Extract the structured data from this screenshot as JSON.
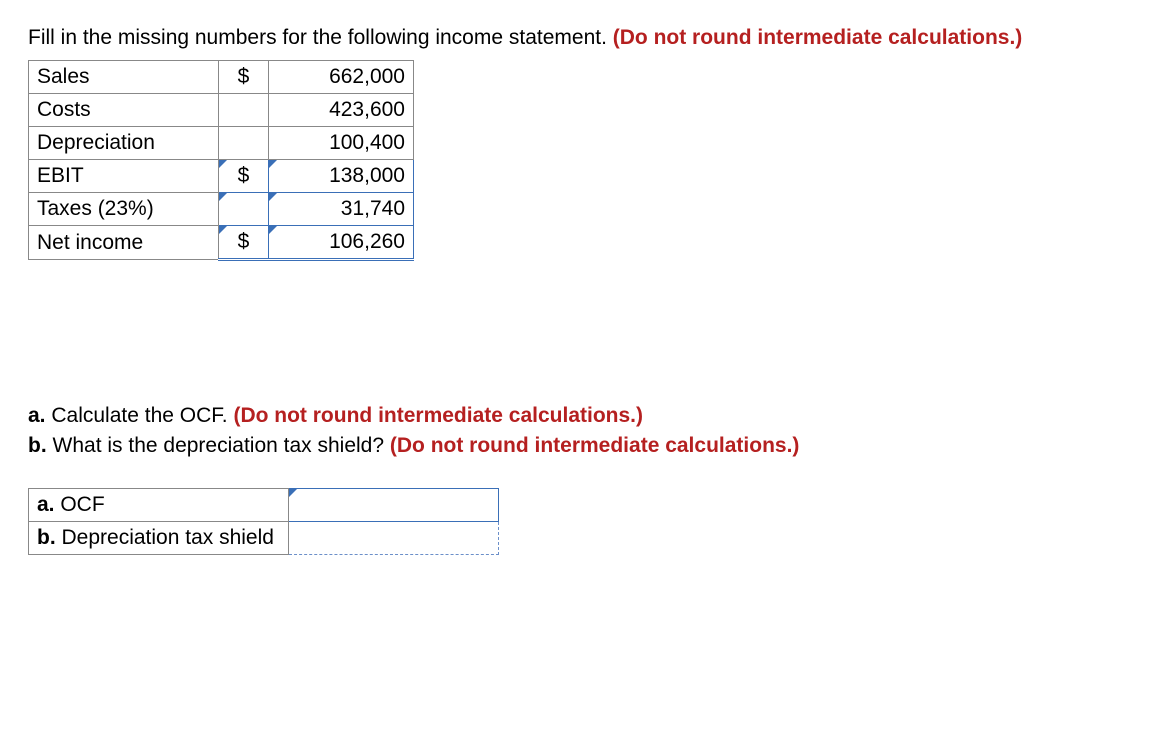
{
  "prompt": {
    "text_before": "Fill in the missing numbers for the following income statement. ",
    "red_text": "(Do not round intermediate calculations.)"
  },
  "income_table": {
    "rows": [
      {
        "label": "Sales",
        "currency": "$",
        "value": "662,000",
        "answer": false
      },
      {
        "label": "Costs",
        "currency": "",
        "value": "423,600",
        "answer": false
      },
      {
        "label": "Depreciation",
        "currency": "",
        "value": "100,400",
        "answer": false
      },
      {
        "label": "EBIT",
        "currency": "$",
        "value": "138,000",
        "answer": true
      },
      {
        "label": "Taxes (23%)",
        "currency": "",
        "value": "31,740",
        "answer": true
      },
      {
        "label": "Net income",
        "currency": "$",
        "value": "106,260",
        "answer": true,
        "net": true
      }
    ]
  },
  "questions": {
    "a_prefix": "a.",
    "a_text": "Calculate the OCF. ",
    "a_red": "(Do not round intermediate calculations.)",
    "b_prefix": "b.",
    "b_text": "What is the depreciation tax shield? ",
    "b_red": "(Do not round intermediate calculations.)"
  },
  "answer_table": {
    "rows": [
      {
        "prefix": "a.",
        "label": "OCF",
        "style": "top-answer"
      },
      {
        "prefix": "b.",
        "label": "Depreciation tax shield",
        "style": "dashed"
      }
    ]
  }
}
